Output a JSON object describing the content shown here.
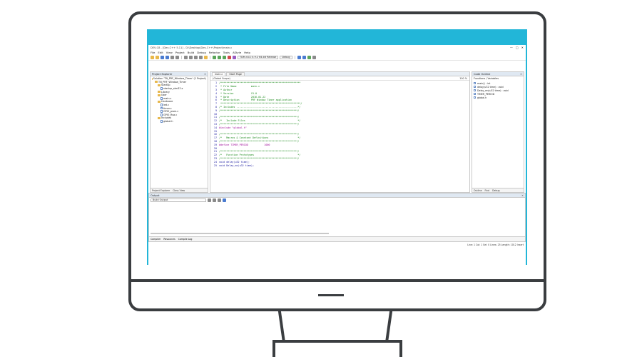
{
  "window": {
    "title": "DEV-C8 - [Dev-C++ 5.11] - D:\\Desktop\\Dev-C++\\Project\\main.c",
    "controls": [
      "—",
      "□",
      "✕"
    ]
  },
  "menu": [
    "File",
    "Edit",
    "View",
    "Project",
    "Build",
    "Debug",
    "Refactor",
    "Tools",
    "AStyle",
    "Help"
  ],
  "toolbar": {
    "config_select": "TDM-GCC 4.9.2 64-bit Release",
    "build_select": "Debug"
  },
  "project_panel": {
    "title": "Project Explorer",
    "tree": [
      {
        "kind": "folder",
        "label": "Solution 'TN_PRF_Window_Timer' (1 Project)",
        "depth": 0
      },
      {
        "kind": "folder",
        "label": "TN_PRF_Window_Timer",
        "depth": 1
      },
      {
        "kind": "folder",
        "label": "Startup",
        "depth": 2
      },
      {
        "kind": "file",
        "label": "startup_stm32.s",
        "depth": 3
      },
      {
        "kind": "folder",
        "label": "Library",
        "depth": 2
      },
      {
        "kind": "folder",
        "label": "User",
        "depth": 2
      },
      {
        "kind": "file",
        "label": "main.c",
        "depth": 3
      },
      {
        "kind": "folder",
        "label": "Hardware",
        "depth": 2
      },
      {
        "kind": "file",
        "label": "led.c",
        "depth": 3
      },
      {
        "kind": "file",
        "label": "timer.c",
        "depth": 3
      },
      {
        "kind": "file",
        "label": "GPIO_pwm.c",
        "depth": 3
      },
      {
        "kind": "file",
        "label": "GPIO_Rsa.c",
        "depth": 3
      },
      {
        "kind": "folder",
        "label": "Includes",
        "depth": 2
      },
      {
        "kind": "file",
        "label": "global.h",
        "depth": 3
      }
    ],
    "footer_tabs": [
      "Project Explorer",
      "Class View"
    ]
  },
  "editor": {
    "tabs": [
      "main.c",
      "Start Page"
    ],
    "breadcrumb": "(Global Scope)",
    "zoom": "100 %",
    "lines": [
      {
        "n": "1",
        "t": "/*******************************************************",
        "c": "cm"
      },
      {
        "n": "2",
        "t": " * File Name          main.c",
        "c": "cm"
      },
      {
        "n": "3",
        "t": " * Author",
        "c": "cm"
      },
      {
        "n": "4",
        "t": " * Version            V1.0",
        "c": "cm"
      },
      {
        "n": "5",
        "t": " * Date               2016-01-22",
        "c": "cm"
      },
      {
        "n": "6",
        "t": " * Description        PRF Window Timer application",
        "c": "cm"
      },
      {
        "n": "7",
        "t": " *******************************************************/",
        "c": "cm"
      },
      {
        "n": "8",
        "t": "/* Includes ------------------------------------------*/",
        "c": "cm"
      },
      {
        "n": "9",
        "t": "/*****************************************************/",
        "c": "cm"
      },
      {
        "n": "10",
        "t": "",
        "c": "tx"
      },
      {
        "n": "11",
        "t": "/*****************************************************/",
        "c": "cm"
      },
      {
        "n": "12",
        "t": "/*   Include Files                                    */",
        "c": "cm"
      },
      {
        "n": "13",
        "t": "/*****************************************************/",
        "c": "cm"
      },
      {
        "n": "14",
        "t": "#include \"global.h\"",
        "c": "pp"
      },
      {
        "n": "15",
        "t": "",
        "c": "tx"
      },
      {
        "n": "16",
        "t": "/*****************************************************/",
        "c": "cm"
      },
      {
        "n": "17",
        "t": "/*   Macros & Constant Definitions                    */",
        "c": "cm"
      },
      {
        "n": "18",
        "t": "/*****************************************************/",
        "c": "cm"
      },
      {
        "n": "19",
        "t": "#define TIMER_PERIOD           1000",
        "c": "pp"
      },
      {
        "n": "20",
        "t": "",
        "c": "tx"
      },
      {
        "n": "21",
        "t": "/*****************************************************/",
        "c": "cm"
      },
      {
        "n": "22",
        "t": "/*   Function Prototypes                              */",
        "c": "cm"
      },
      {
        "n": "23",
        "t": "/*****************************************************/",
        "c": "cm"
      },
      {
        "n": "24",
        "t": "void delay(u32 time);",
        "c": "kw"
      },
      {
        "n": "25",
        "t": "void Delay_ms(u32 time);",
        "c": "kw"
      }
    ]
  },
  "outline_panel": {
    "title": "Code Outline",
    "header": "Functions / Variables",
    "items": [
      "main() : int",
      "delay(u32 time) : void",
      "Delay_ms(u32 time) : void",
      "TIMER_PERIOD",
      "global.h"
    ],
    "footer_tabs": [
      "Outline",
      "Find",
      "Debug"
    ]
  },
  "output": {
    "title": "Output",
    "source_select": "Build Output",
    "tabs": [
      "Compiler",
      "Resources",
      "Compile Log"
    ]
  },
  "status": {
    "text": "Line: 1  Col: 1  Sel: 0  Lines: 25  Length: 1012  Insert"
  }
}
